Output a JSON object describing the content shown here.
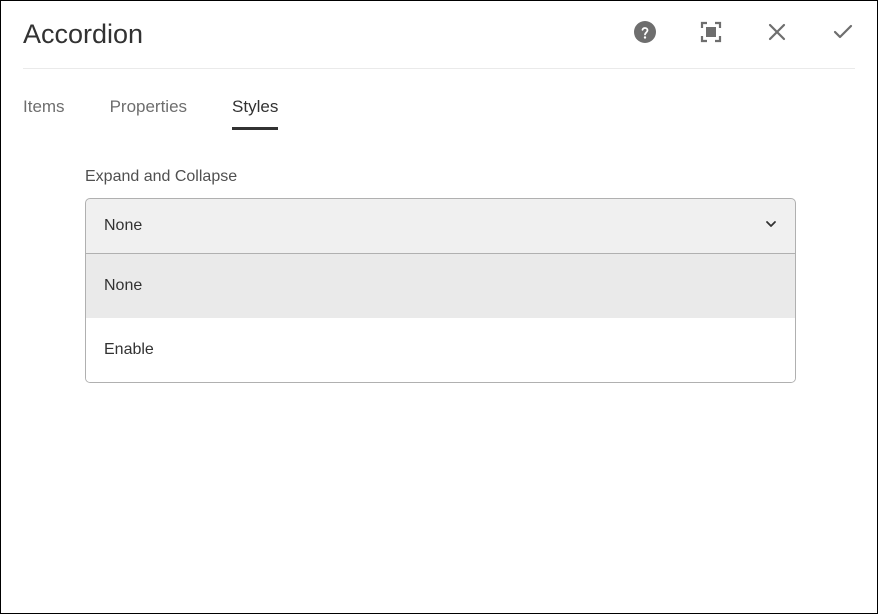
{
  "dialog": {
    "title": "Accordion"
  },
  "tabs": {
    "items": [
      {
        "label": "Items",
        "active": false
      },
      {
        "label": "Properties",
        "active": false
      },
      {
        "label": "Styles",
        "active": true
      }
    ]
  },
  "field": {
    "label": "Expand and Collapse",
    "selected": "None",
    "options": [
      {
        "label": "None",
        "selected": true
      },
      {
        "label": "Enable",
        "selected": false
      }
    ]
  }
}
